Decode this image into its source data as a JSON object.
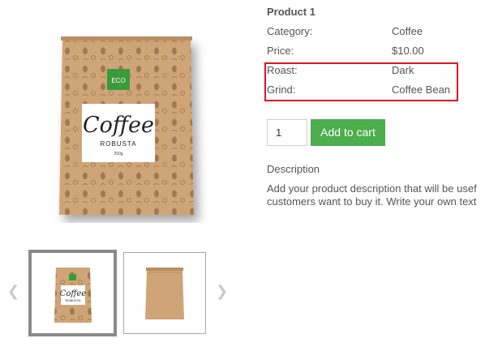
{
  "product": {
    "title": "Product 1",
    "attributes": [
      {
        "label": "Category:",
        "value": "Coffee"
      },
      {
        "label": "Price:",
        "value": "$10.00"
      },
      {
        "label": "Roast:",
        "value": "Dark"
      },
      {
        "label": "Grind:",
        "value": "Coffee Bean"
      }
    ],
    "quantity": "1",
    "add_to_cart_label": "Add to cart",
    "description_heading": "Description",
    "description_lines": [
      "Add your product description that will be usef",
      "customers want to buy it. Write your own text"
    ]
  },
  "package": {
    "badge": "ECO",
    "word": "Coffee",
    "variety": "ROBUSTA",
    "weight": "250g"
  },
  "gallery": {
    "prev_icon": "chevron-left-icon",
    "next_icon": "chevron-right-icon"
  },
  "colors": {
    "button": "#4cae4c",
    "highlight": "#e0141e",
    "bag": "#cfa578",
    "badge": "#3a9b3a"
  }
}
